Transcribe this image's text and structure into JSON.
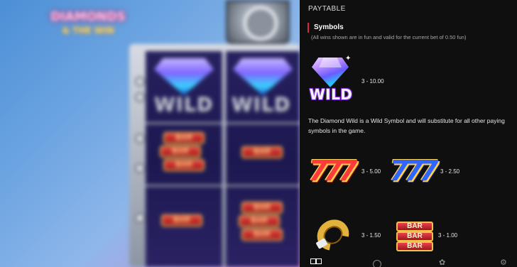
{
  "panel": {
    "title": "PAYTABLE",
    "section_title": "Symbols",
    "note": "(All wins shown are in fun and valid for the current bet of 0.50 fun)",
    "wild_label": "WILD",
    "wild_description": "The Diamond Wild is a Wild Symbol and will substitute for all other paying symbols in the game.",
    "symbols": [
      {
        "name": "diamond-wild",
        "payout": "3 - 10.00"
      },
      {
        "name": "red-777",
        "payout": "3 - 5.00"
      },
      {
        "name": "blue-777",
        "payout": "3 - 2.50"
      },
      {
        "name": "horseshoe",
        "payout": "3 - 1.50"
      },
      {
        "name": "triple-bar",
        "payout": "3 - 1.00"
      }
    ],
    "bar_text": "BAR",
    "seven_text": "777"
  },
  "game": {
    "logo_line1": "DIAMONDS",
    "logo_line2": "& THE WIN",
    "reel_wild_label": "WILD",
    "reel_bar_label": "BAR"
  },
  "nav": {
    "items": [
      "paytable-icon",
      "info-icon",
      "settings-icon",
      "gear-icon"
    ]
  },
  "colors": {
    "panel_bg": "#0f0f10",
    "accent": "#e0263d",
    "text": "#e8e8e8",
    "muted": "#a8a8a8"
  }
}
